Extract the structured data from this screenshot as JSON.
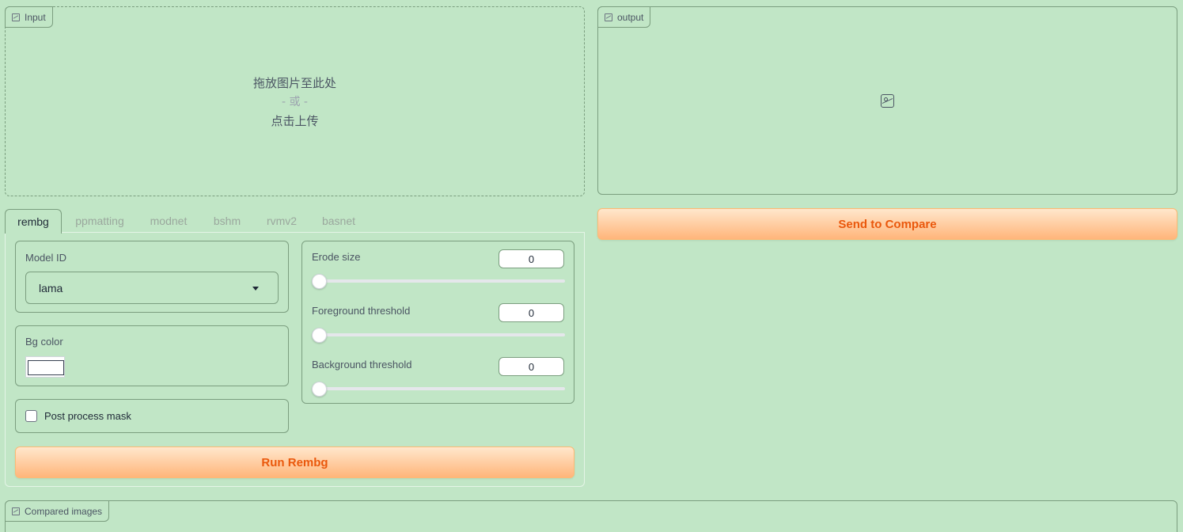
{
  "input_panel": {
    "label": "Input",
    "drop_text": "拖放图片至此处",
    "or_text": "- 或 -",
    "click_text": "点击上传"
  },
  "output_panel": {
    "label": "output"
  },
  "send_button": "Send to Compare",
  "tabs": [
    "rembg",
    "ppmatting",
    "modnet",
    "bshm",
    "rvmv2",
    "basnet"
  ],
  "active_tab": "rembg",
  "model": {
    "label": "Model ID",
    "value": "lama"
  },
  "bg_color": {
    "label": "Bg color",
    "value": "#ffffff"
  },
  "post_process": {
    "label": "Post process mask",
    "checked": false
  },
  "sliders": [
    {
      "label": "Erode size",
      "value": "0"
    },
    {
      "label": "Foreground threshold",
      "value": "0"
    },
    {
      "label": "Background threshold",
      "value": "0"
    }
  ],
  "run_button": "Run Rembg",
  "compared_panel": {
    "label": "Compared images"
  },
  "colors": {
    "background": "#c1e6c6",
    "accent": "#ea580c"
  },
  "icons": {
    "image": "image-icon",
    "dropdown": "chevron-down-icon"
  }
}
